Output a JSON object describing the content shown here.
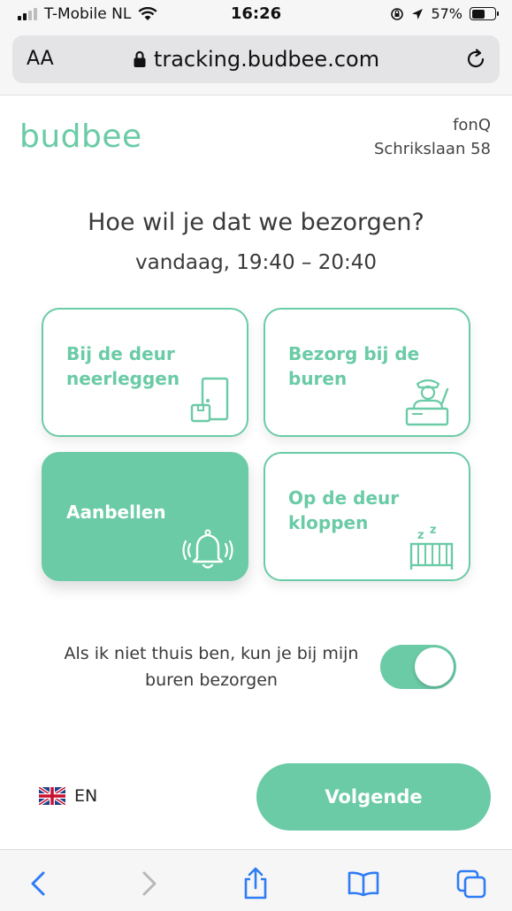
{
  "status_bar": {
    "carrier": "T-Mobile NL",
    "time": "16:26",
    "battery": "57%",
    "battery_level": 0.57
  },
  "browser": {
    "text_size_label": "AA",
    "url": "tracking.budbee.com"
  },
  "header": {
    "brand": "budbee",
    "merchant_name": "fonQ",
    "address": "Schrikslaan 58"
  },
  "main": {
    "question": "Hoe wil je dat we bezorgen?",
    "time_window": "vandaag, 19:40 – 20:40",
    "options": [
      {
        "label": "Bij de deur neerleggen",
        "icon": "door-package-icon",
        "selected": false
      },
      {
        "label": "Bezorg bij de buren",
        "icon": "neighbor-person-icon",
        "selected": false
      },
      {
        "label": "Aanbellen",
        "icon": "ringing-bell-icon",
        "selected": true
      },
      {
        "label": "Op de deur kloppen",
        "icon": "sleeping-crib-icon",
        "selected": false
      }
    ],
    "neighbors_text": "Als ik niet thuis ben, kun je bij mijn buren bezorgen",
    "neighbors_toggle_on": true
  },
  "footer": {
    "language": "EN",
    "next_label": "Volgende"
  },
  "colors": {
    "accent": "#6acba6"
  }
}
